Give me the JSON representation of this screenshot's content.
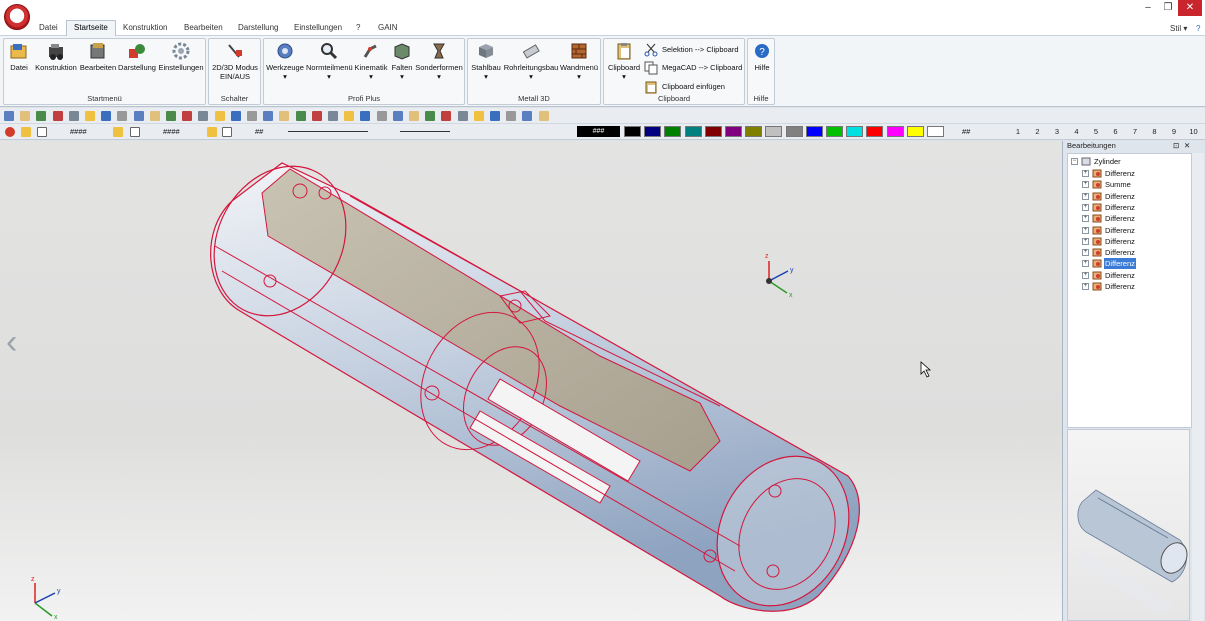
{
  "window": {
    "stil_label": "Stil",
    "minimize": "–",
    "restore": "❐",
    "close": "✕"
  },
  "tabs": [
    "Datei",
    "Startseite",
    "Konstruktion",
    "Bearbeiten",
    "Darstellung",
    "Einstellungen",
    "?",
    "GAIN"
  ],
  "active_tab": "Startseite",
  "ribbon": {
    "startmenu": {
      "label": "Startmenü",
      "buttons": [
        "Datei",
        "Konstruktion",
        "Bearbeiten",
        "Darstellung",
        "Einstellungen"
      ]
    },
    "schalter": {
      "label": "Schalter",
      "button_line1": "2D/3D Modus",
      "button_line2": "EIN/AUS"
    },
    "profi_plus": {
      "label": "Profi Plus",
      "buttons": [
        "Werkzeuge",
        "Normteilmenü",
        "Kinematik",
        "Falten",
        "Sonderformen"
      ]
    },
    "metall_3d": {
      "label": "Metall 3D",
      "buttons": [
        "Stahlbau",
        "Rohrleitungsbau",
        "Wandmenü"
      ]
    },
    "clipboard": {
      "label": "Clipboard",
      "big_button": "Clipboard",
      "selektion": "Selektion --> Clipboard",
      "megacad": "MegaCAD --> Clipboard",
      "einfuegen": "Clipboard einfügen"
    },
    "hilfe": {
      "label": "Hilfe",
      "button": "Hilfe"
    }
  },
  "toolbar2": {
    "field1": "####",
    "field2": "####",
    "field3": "##",
    "color_field": "###",
    "grid_label": "##",
    "layer_numbers": [
      "1",
      "2",
      "3",
      "4",
      "5",
      "6",
      "7",
      "8",
      "9",
      "10"
    ],
    "colors": [
      "#000000",
      "#000080",
      "#008000",
      "#008080",
      "#800000",
      "#800080",
      "#808000",
      "#c0c0c0",
      "#808080",
      "#0000ff",
      "#00c000",
      "#00e0e0",
      "#ff0000",
      "#ff00ff",
      "#ffff00",
      "#ffffff"
    ]
  },
  "panel": {
    "title": "Bearbeitungen",
    "root": "Zylinder",
    "nodes": [
      "Differenz",
      "Summe",
      "Differenz",
      "Differenz",
      "Differenz",
      "Differenz",
      "Differenz",
      "Differenz",
      "Differenz",
      "Differenz",
      "Differenz"
    ],
    "selected_index": 8
  },
  "viewport": {
    "axis_labels": {
      "x": "x",
      "y": "y",
      "z": "z"
    },
    "nav_arrow": "‹",
    "wire_color": "#d4163c",
    "body_color": "#b9c6d6"
  }
}
